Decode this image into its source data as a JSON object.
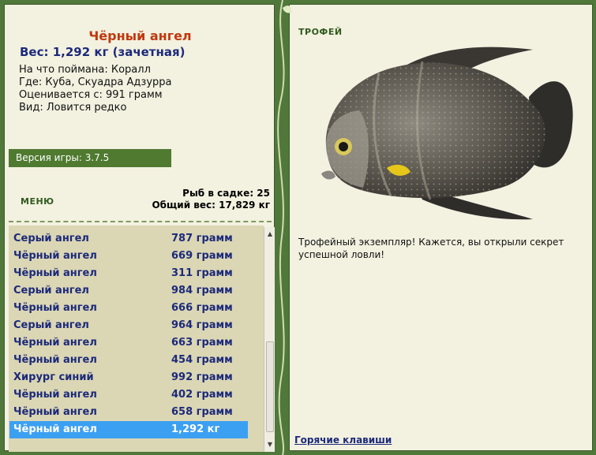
{
  "fish": {
    "title": "Чёрный ангел",
    "weight": "Вес: 1,292 кг (зачетная)",
    "caught_on": "На что поймана: Коралл",
    "location": "Где: Куба, Скуадра Адзурра",
    "valued_from": "Оценивается с: 991 грамм",
    "rarity": "Вид: Ловится редко"
  },
  "version": "Версия игры: 3.7.5",
  "menu_label": "МЕНЮ",
  "stats": {
    "count": "Рыб в садке: 25",
    "total": "Общий вес: 17,829 кг"
  },
  "catch_list": [
    {
      "name": "Серый ангел",
      "weight": "787 грамм"
    },
    {
      "name": "Чёрный ангел",
      "weight": "669 грамм"
    },
    {
      "name": "Чёрный ангел",
      "weight": "311 грамм"
    },
    {
      "name": "Серый ангел",
      "weight": "984 грамм"
    },
    {
      "name": "Чёрный ангел",
      "weight": "666 грамм"
    },
    {
      "name": "Серый ангел",
      "weight": "964 грамм"
    },
    {
      "name": "Чёрный ангел",
      "weight": "663 грамм"
    },
    {
      "name": "Чёрный ангел",
      "weight": "454 грамм"
    },
    {
      "name": "Хирург синий",
      "weight": "992 грамм"
    },
    {
      "name": "Чёрный ангел",
      "weight": "402 грамм"
    },
    {
      "name": "Чёрный ангел",
      "weight": "658 грамм"
    },
    {
      "name": "Чёрный ангел",
      "weight": "1,292 кг"
    }
  ],
  "trophy": {
    "label": "ТРОФЕЙ",
    "message": "Трофейный экземпляр! Кажется, вы открыли секрет успешной ловли!"
  },
  "hotkeys_label": "Горячие клавиши",
  "colors": {
    "frame": "#50783a",
    "panel": "#f3f1e0",
    "list_bg": "#dbd6b4",
    "selected": "#3ca0f2",
    "title": "#c0390e",
    "text_blue": "#1c2a7a"
  },
  "icons": {
    "scroll_up": "▲",
    "scroll_down": "▼"
  }
}
